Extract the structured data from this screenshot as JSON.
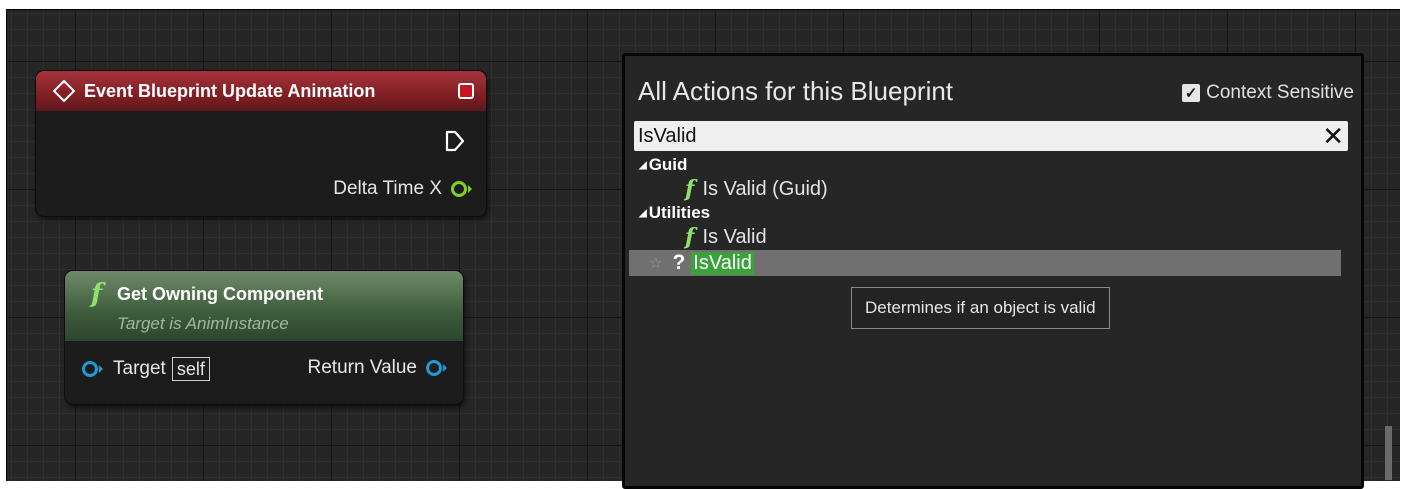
{
  "event_node": {
    "title": "Event Blueprint Update Animation",
    "pin_delta": "Delta Time X"
  },
  "get_node": {
    "glyph": "f",
    "title": "Get Owning Component",
    "subtitle": "Target is AnimInstance",
    "pin_target": "Target",
    "pin_target_default": "self",
    "pin_return": "Return Value"
  },
  "panel": {
    "title": "All Actions for this Blueprint",
    "context_label": "Context Sensitive",
    "context_checked": true,
    "search_value": "IsValid",
    "clear_glyph": "✕",
    "categories": [
      {
        "label": "Guid",
        "items": [
          {
            "label": "Is Valid (Guid)"
          }
        ]
      },
      {
        "label": "Utilities",
        "items": [
          {
            "label": "Is Valid"
          },
          {
            "label": "IsValid"
          }
        ]
      }
    ],
    "tooltip": "Determines if an object is valid"
  },
  "colors": {
    "event_header": "#7a1c22",
    "function_header": "#3d5c3b",
    "object_pin": "#1e9ad6",
    "float_pin": "#7ed321",
    "highlight": "#3aa13b"
  }
}
